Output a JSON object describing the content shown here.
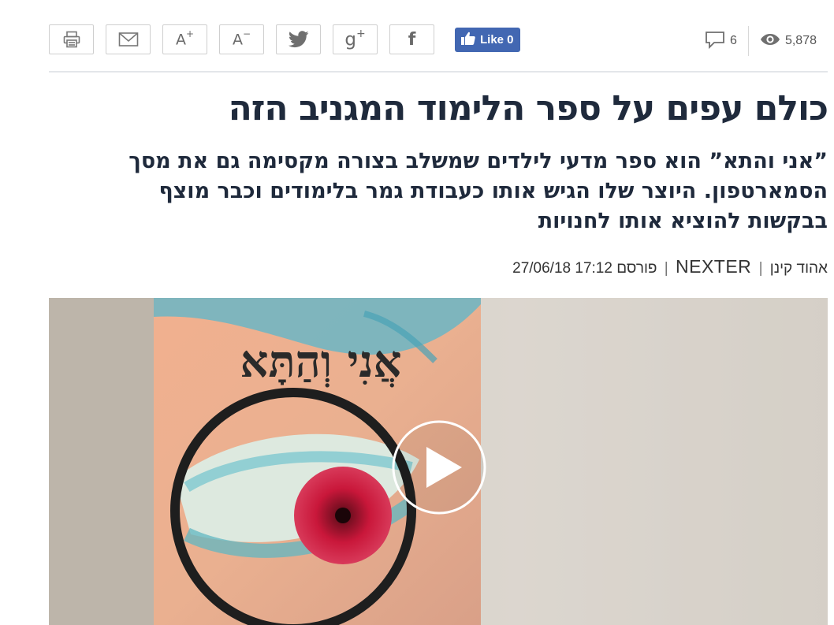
{
  "toolbar": {
    "font_increase": {
      "main": "A",
      "sup": "+"
    },
    "font_decrease": {
      "main": "A",
      "sup": "−"
    },
    "gplus": {
      "main": "g",
      "sup": "+"
    },
    "facebook": "f",
    "like_label": "Like 0"
  },
  "stats": {
    "comments": "6",
    "views": "5,878"
  },
  "article": {
    "headline": "כולם עפים על ספר הלימוד המגניב הזה",
    "subtitle": "”אני והתא” הוא ספר מדעי לילדים שמשלב בצורה מקסימה גם את מסך הסמארטפון. היוצר שלו הגיש אותו כעבודת גמר בלימודים וכבר מוצף בבקשות להוציא אותו לחנויות",
    "author": "אהוד קינן",
    "publisher": "NEXTER",
    "published_label": "פורסם",
    "date": "27/06/18 17:12",
    "sep": "|"
  },
  "video": {
    "book_title": "אֲנִי וְהַתָּא"
  },
  "colors": {
    "facebook_like": "#4267b2",
    "headline": "#1f2a3c",
    "rule": "#e3e6ea",
    "iris": "#c9173a"
  }
}
